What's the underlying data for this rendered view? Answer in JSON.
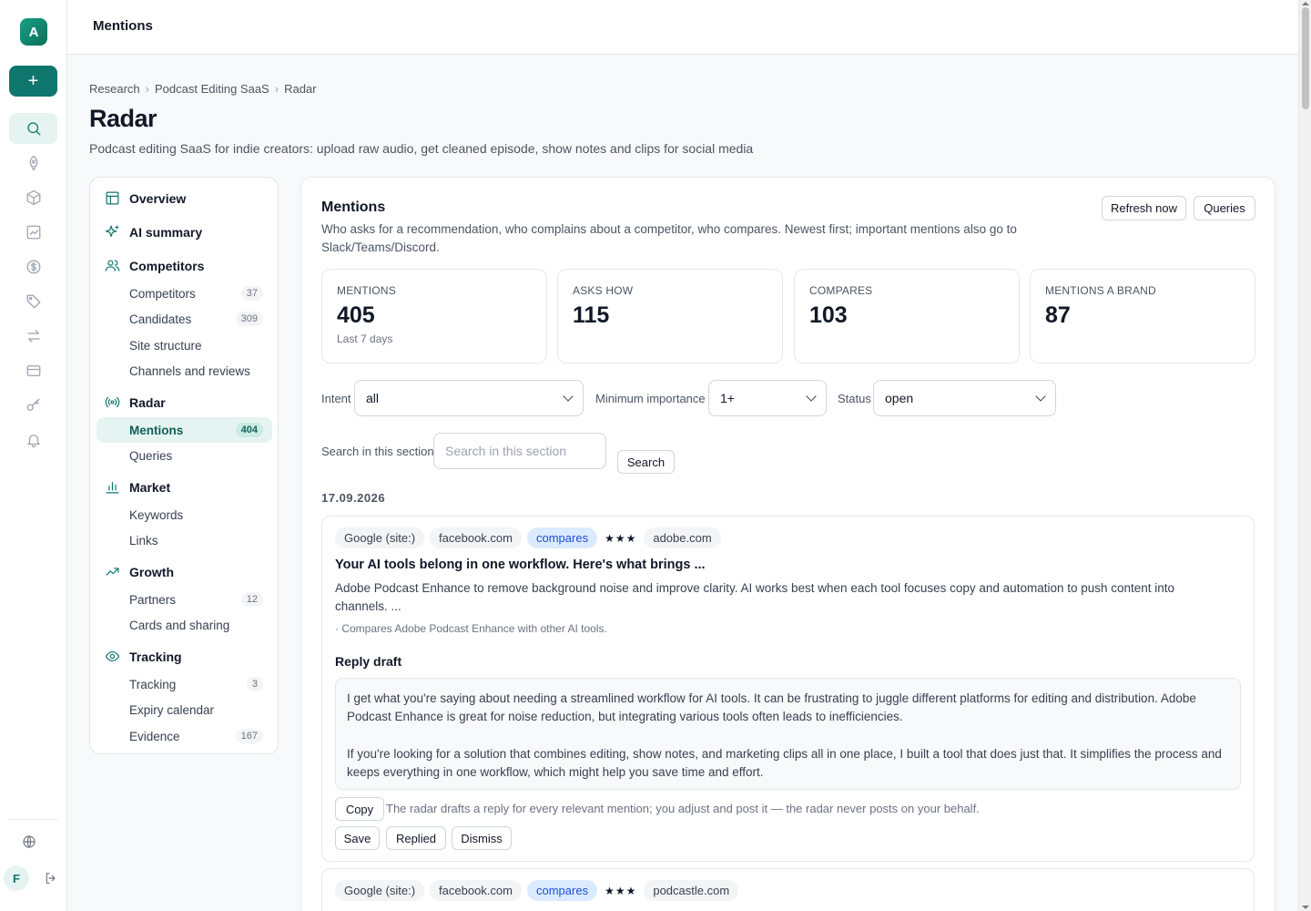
{
  "rail": {
    "avatar": "A",
    "add": "+",
    "user": "F",
    "items": [
      "search-icon",
      "rocket-icon",
      "cube-icon",
      "chart-icon",
      "dollar-icon",
      "tag-icon",
      "swap-icon",
      "card-icon",
      "key-icon",
      "bell-icon"
    ]
  },
  "topbar": {
    "title": "Mentions"
  },
  "breadcrumb": [
    "Research",
    "Podcast Editing SaaS",
    "Radar"
  ],
  "page": {
    "title": "Radar",
    "subtitle": "Podcast editing SaaS for indie creators: upload raw audio, get cleaned episode, show notes and clips for social media"
  },
  "nav": {
    "overview": "Overview",
    "ai_summary": "AI summary",
    "competitors": {
      "label": "Competitors",
      "items": [
        {
          "label": "Competitors",
          "count": "37"
        },
        {
          "label": "Candidates",
          "count": "309"
        },
        {
          "label": "Site structure",
          "count": ""
        },
        {
          "label": "Channels and reviews",
          "count": ""
        }
      ]
    },
    "radar": {
      "label": "Radar",
      "items": [
        {
          "label": "Mentions",
          "count": "404"
        },
        {
          "label": "Queries",
          "count": ""
        }
      ]
    },
    "market": {
      "label": "Market",
      "items": [
        {
          "label": "Keywords",
          "count": ""
        },
        {
          "label": "Links",
          "count": ""
        }
      ]
    },
    "growth": {
      "label": "Growth",
      "items": [
        {
          "label": "Partners",
          "count": "12"
        },
        {
          "label": "Cards and sharing",
          "count": ""
        }
      ]
    },
    "tracking": {
      "label": "Tracking",
      "items": [
        {
          "label": "Tracking",
          "count": "3"
        },
        {
          "label": "Expiry calendar",
          "count": ""
        },
        {
          "label": "Evidence",
          "count": "167"
        }
      ]
    }
  },
  "main": {
    "title": "Mentions",
    "description": "Who asks for a recommendation, who complains about a competitor, who compares. Newest first; important mentions also go to Slack/Teams/Discord.",
    "refresh_label": "Refresh now",
    "queries_label": "Queries",
    "stats": [
      {
        "label": "Mentions",
        "value": "405",
        "note": "Last 7 days"
      },
      {
        "label": "Asks how",
        "value": "115",
        "note": ""
      },
      {
        "label": "Compares",
        "value": "103",
        "note": ""
      },
      {
        "label": "Mentions a brand",
        "value": "87",
        "note": ""
      }
    ],
    "filters": {
      "intent_label": "Intent",
      "intent_value": "all",
      "importance_label": "Minimum importance",
      "importance_value": "1+",
      "status_label": "Status",
      "status_value": "open",
      "search_label": "Search in this section",
      "search_placeholder": "Search in this section",
      "search_button": "Search"
    },
    "date": "17.09.2026",
    "mentions": [
      {
        "source": "Google (site:)",
        "domain": "facebook.com",
        "intent": "compares",
        "stars": "★★★",
        "brand": "adobe.com",
        "title": "Your AI tools belong in one workflow. Here's what brings ...",
        "excerpt": "Adobe Podcast Enhance to remove background noise and improve clarity. AI works best when each tool focuses copy and automation to push content into channels. ...",
        "note": "· Compares Adobe Podcast Enhance with other AI tools.",
        "draft_label": "Reply draft",
        "draft_p1": "I get what you're saying about needing a streamlined workflow for AI tools. It can be frustrating to juggle different platforms for editing and distribution. Adobe Podcast Enhance is great for noise reduction, but integrating various tools often leads to inefficiencies.",
        "draft_p2": "If you're looking for a solution that combines editing, show notes, and marketing clips all in one place, I built a tool that does just that. It simplifies the process and keeps everything in one workflow, which might help you save time and effort.",
        "copy_label": "Copy",
        "copy_hint": "The radar drafts a reply for every relevant mention; you adjust and post it — the radar never posts on your behalf.",
        "save_label": "Save",
        "replied_label": "Replied",
        "dismiss_label": "Dismiss"
      },
      {
        "source": "Google (site:)",
        "domain": "facebook.com",
        "intent": "compares",
        "stars": "★★★",
        "brand": "podcastle.com"
      }
    ]
  }
}
